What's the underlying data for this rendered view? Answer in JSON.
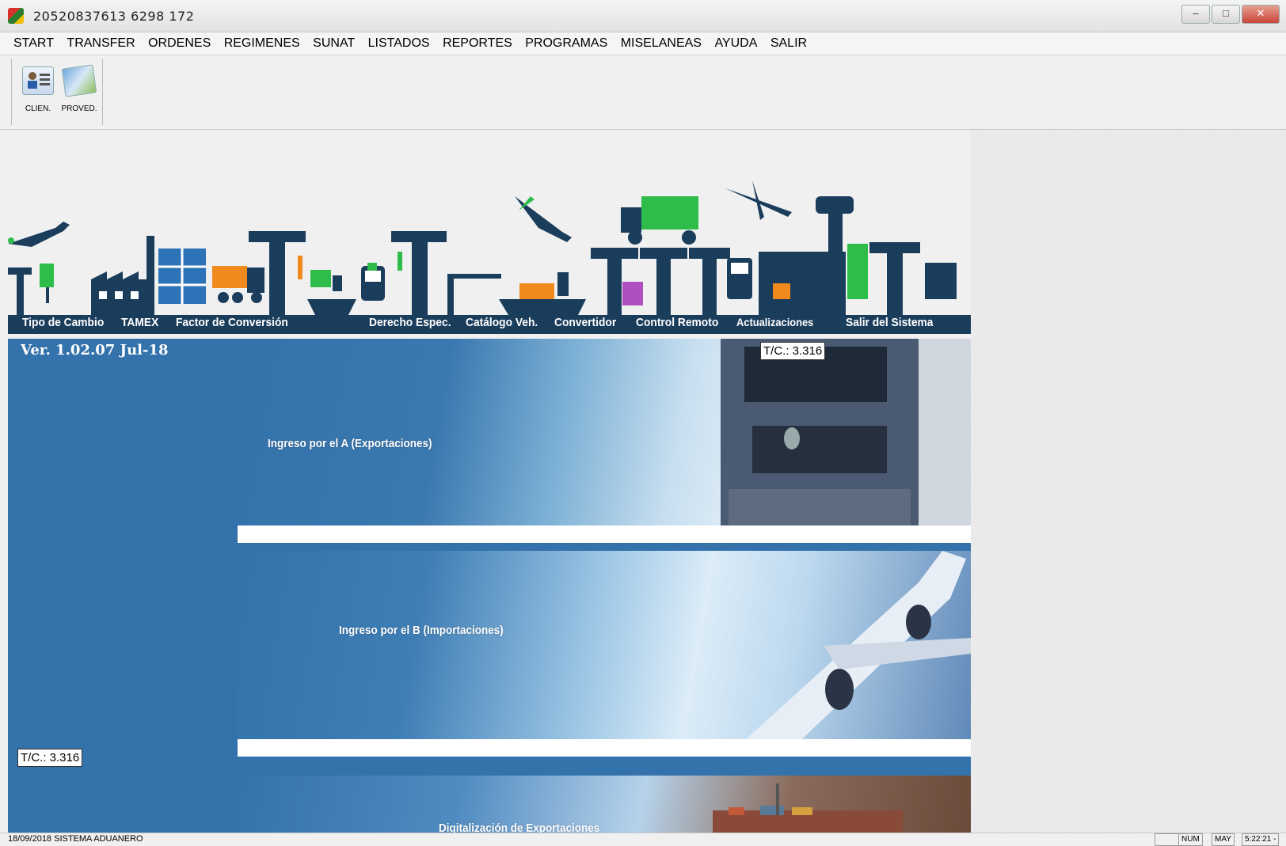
{
  "window": {
    "title": "20520837613   6298   172",
    "controls": [
      "–",
      "□",
      "✕"
    ]
  },
  "menu": [
    "START",
    "TRANSFER",
    "ORDENES",
    "REGIMENES",
    "SUNAT",
    "LISTADOS",
    "REPORTES",
    "PROGRAMAS",
    "MISELANEAS",
    "AYUDA",
    "SALIR"
  ],
  "toolbar": {
    "clients_label": "CLIEN.",
    "providers_label": "PROVED."
  },
  "banner": {
    "items": [
      "Tipo de Cambio",
      "TAMEX",
      "Factor de Conversión",
      "Derecho Espec.",
      "Catálogo Veh.",
      "Convertidor",
      "Control Remoto",
      "Actualizaciones",
      "Salir del Sistema"
    ]
  },
  "main": {
    "version": "Ver. 1.02.07 Jul-18",
    "exchange_rate_top": "T/C.: 3.316",
    "exchange_rate_bottom": "T/C.: 3.316",
    "sections": [
      "Ingreso por el A (Exportaciones)",
      "Ingreso por el B (Importaciones)",
      "Digitalización de Exportaciones"
    ]
  },
  "statusbar": {
    "left_text": "18/09/2018 SISTEMA ADUANERO",
    "num": "NUM",
    "may": "MAY",
    "time": "5:22:21 -"
  },
  "colors": {
    "main_bg": "#3472ab",
    "banner_dark": "#1b3d5c",
    "accent_green": "#2ebd4a",
    "accent_orange": "#f08a1c"
  }
}
